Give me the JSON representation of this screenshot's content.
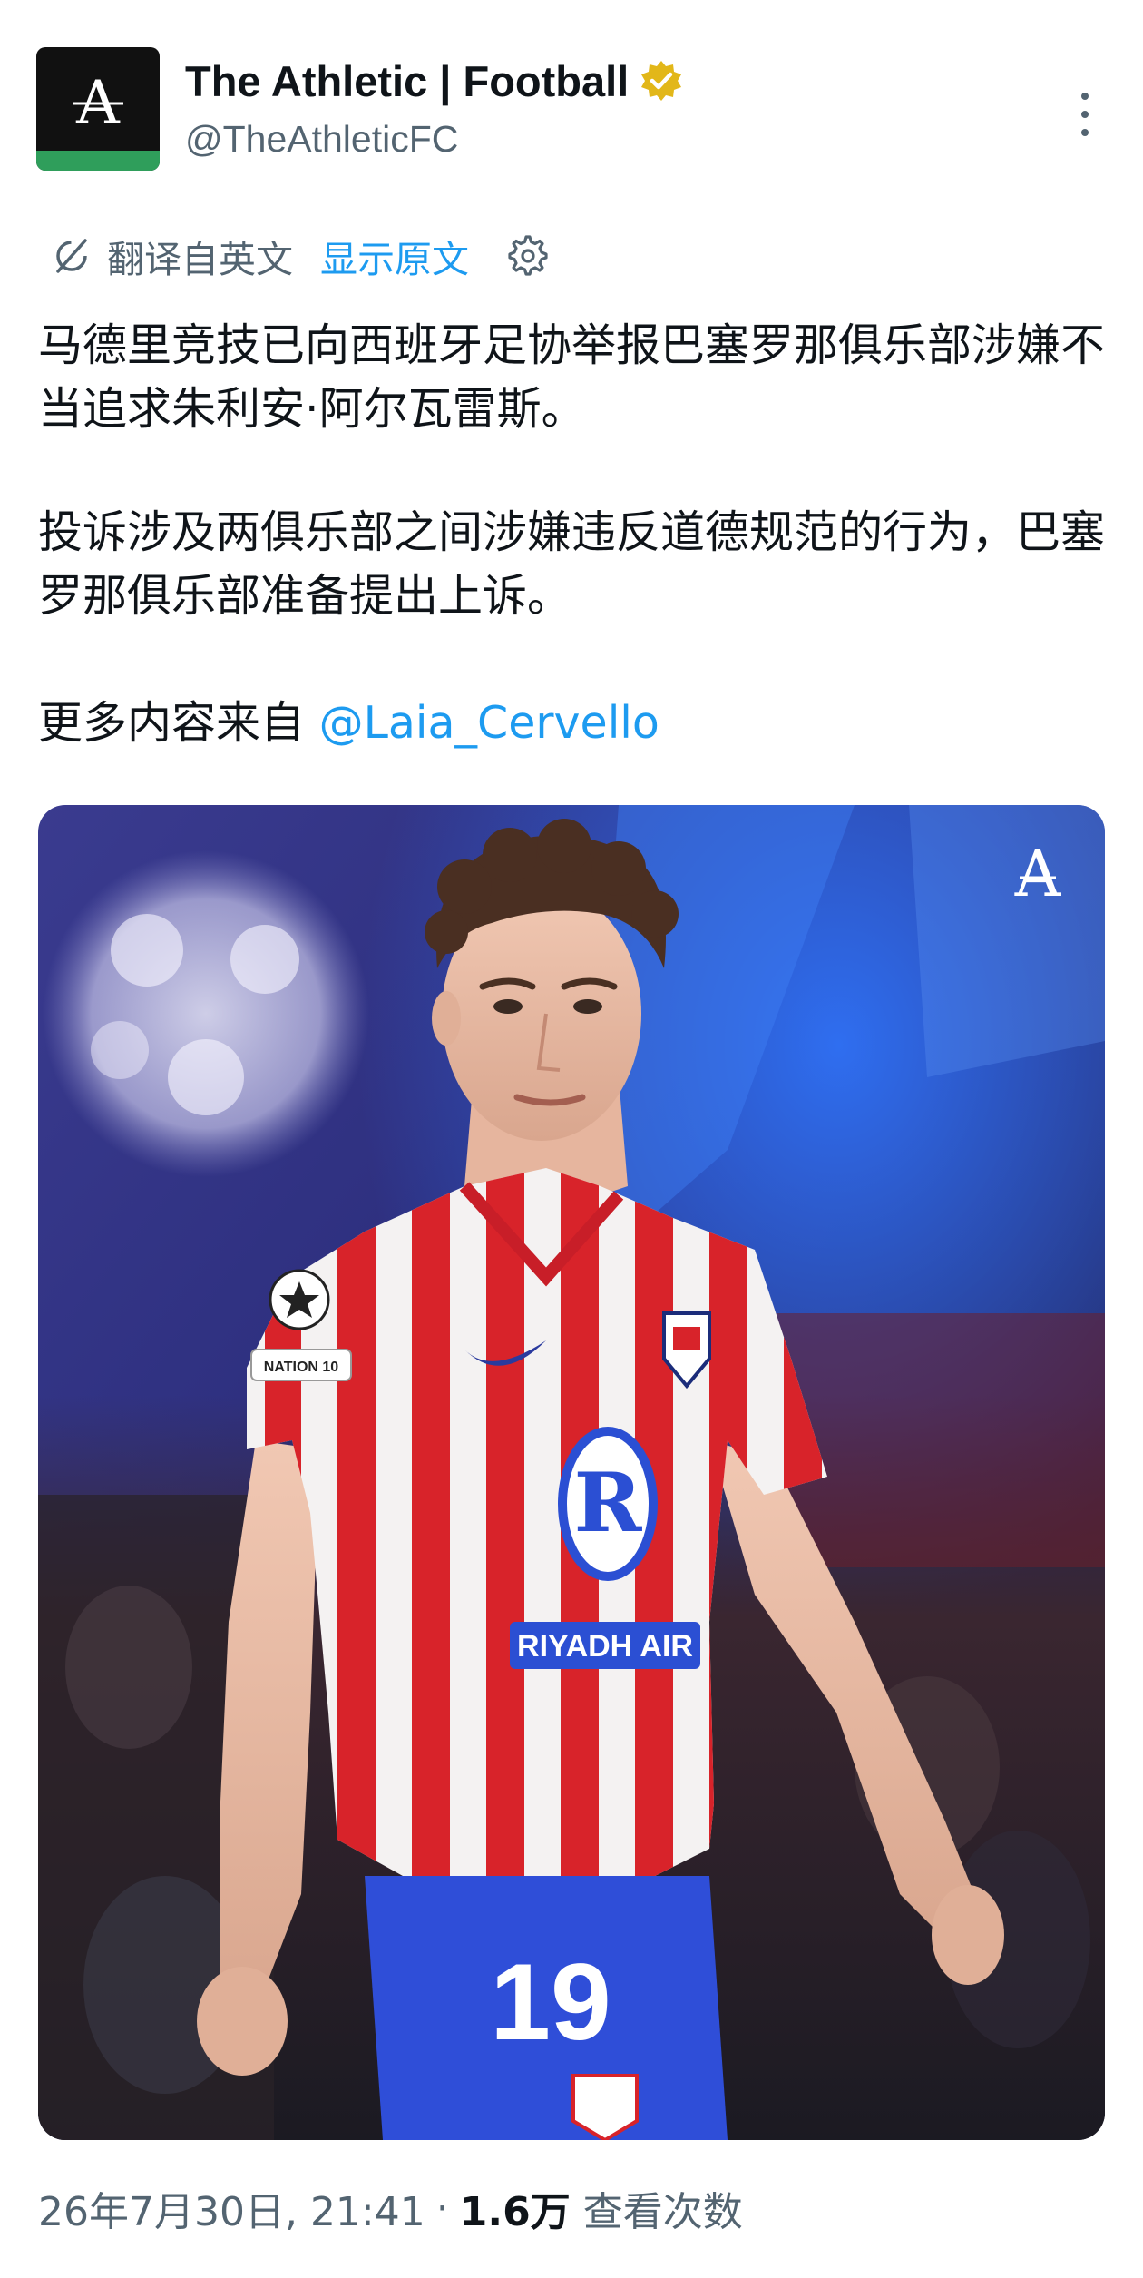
{
  "author": {
    "display_name": "The Athletic | Football",
    "handle": "@TheAthleticFC",
    "avatar_letter": "A",
    "verified_color": "#e2b719",
    "brand_green": "#2f9e5b"
  },
  "translation": {
    "translated_from": "翻译自英文",
    "show_original": "显示原文",
    "icon": "translate-icon",
    "settings_icon": "gear-icon"
  },
  "tweet": {
    "paragraph_1": "马德里竞技已向西班牙足协举报巴塞罗那俱乐部涉嫌不当追求朱利安·阿尔瓦雷斯。",
    "paragraph_2": "投诉涉及两俱乐部之间涉嫌违反道德规范的行为，巴塞罗那俱乐部准备提出上诉。",
    "paragraph_3_prefix": "更多内容来自 ",
    "mention": "@Laia_Cervello"
  },
  "media": {
    "watermark": "A",
    "sleeve_badge_text": "NATION 10",
    "sponsor": "RIYADH AIR",
    "shirt_number": "19"
  },
  "footer": {
    "timestamp": "26年7月30日, 21:41",
    "separator": "·",
    "views_count": "1.6万",
    "views_label": "查看次数"
  },
  "colors": {
    "link_blue": "#1d9bf0",
    "secondary_text": "#536471",
    "primary_text": "#0f1419"
  }
}
